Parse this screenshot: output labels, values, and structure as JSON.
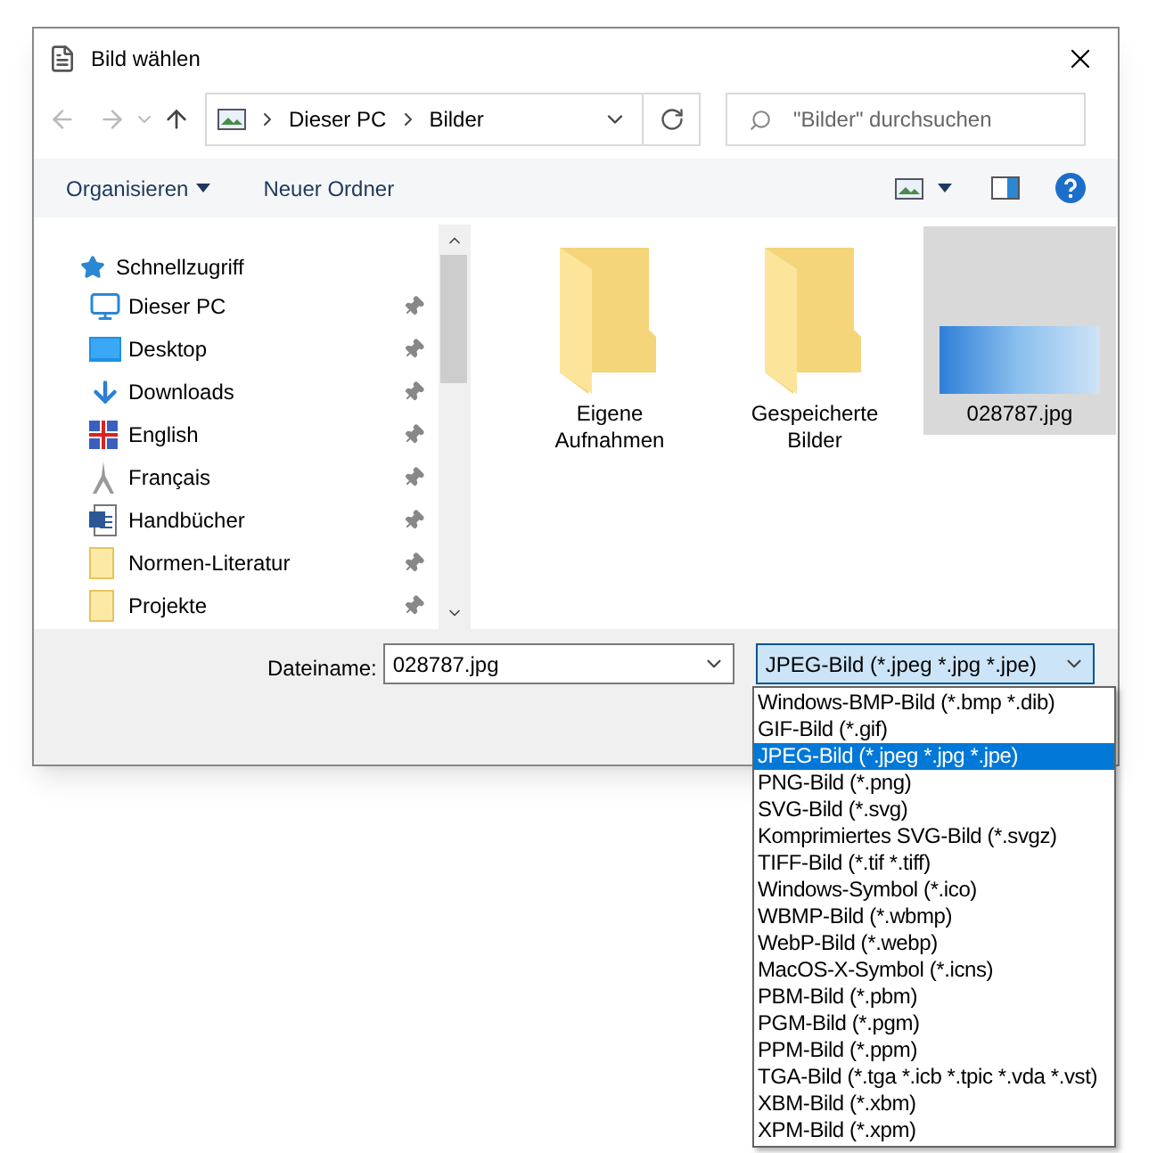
{
  "window": {
    "title": "Bild wählen"
  },
  "address": {
    "crumbs": [
      "Dieser PC",
      "Bilder"
    ]
  },
  "search": {
    "placeholder": "\"Bilder\" durchsuchen"
  },
  "toolbar": {
    "organize": "Organisieren",
    "new_folder": "Neuer Ordner"
  },
  "sidebar": {
    "header": "Schnellzugriff",
    "items": [
      {
        "label": "Dieser PC",
        "kind": "pc",
        "pinned": true
      },
      {
        "label": "Desktop",
        "kind": "desktop",
        "pinned": true
      },
      {
        "label": "Downloads",
        "kind": "download",
        "pinned": true
      },
      {
        "label": "English",
        "kind": "flag",
        "pinned": true
      },
      {
        "label": "Français",
        "kind": "tower",
        "pinned": true
      },
      {
        "label": "Handbücher",
        "kind": "doc",
        "pinned": true
      },
      {
        "label": "Normen-Literatur",
        "kind": "folder",
        "pinned": true
      },
      {
        "label": "Projekte",
        "kind": "folder",
        "pinned": true
      }
    ]
  },
  "files": [
    {
      "name": "Eigene Aufnahmen",
      "kind": "folder",
      "selected": false
    },
    {
      "name": "Gespeicherte Bilder",
      "kind": "folder",
      "selected": false
    },
    {
      "name": "028787.jpg",
      "kind": "image",
      "selected": true
    }
  ],
  "filename": {
    "label": "Dateiname:",
    "value": "028787.jpg"
  },
  "filetype": {
    "value": "JPEG-Bild (*.jpeg *.jpg *.jpe)",
    "expanded": true,
    "options": [
      {
        "label": "Windows-BMP-Bild (*.bmp *.dib)",
        "selected": false
      },
      {
        "label": "GIF-Bild (*.gif)",
        "selected": false
      },
      {
        "label": "JPEG-Bild (*.jpeg *.jpg *.jpe)",
        "selected": true
      },
      {
        "label": "PNG-Bild (*.png)",
        "selected": false
      },
      {
        "label": "SVG-Bild (*.svg)",
        "selected": false
      },
      {
        "label": "Komprimiertes SVG-Bild (*.svgz)",
        "selected": false
      },
      {
        "label": "TIFF-Bild (*.tif *.tiff)",
        "selected": false
      },
      {
        "label": "Windows-Symbol (*.ico)",
        "selected": false
      },
      {
        "label": "WBMP-Bild (*.wbmp)",
        "selected": false
      },
      {
        "label": "WebP-Bild (*.webp)",
        "selected": false
      },
      {
        "label": "MacOS-X-Symbol (*.icns)",
        "selected": false
      },
      {
        "label": "PBM-Bild (*.pbm)",
        "selected": false
      },
      {
        "label": "PGM-Bild (*.pgm)",
        "selected": false
      },
      {
        "label": "PPM-Bild (*.ppm)",
        "selected": false
      },
      {
        "label": "TGA-Bild (*.tga *.icb *.tpic *.vda *.vst)",
        "selected": false
      },
      {
        "label": "XBM-Bild (*.xbm)",
        "selected": false
      },
      {
        "label": "XPM-Bild (*.xpm)",
        "selected": false
      }
    ]
  }
}
